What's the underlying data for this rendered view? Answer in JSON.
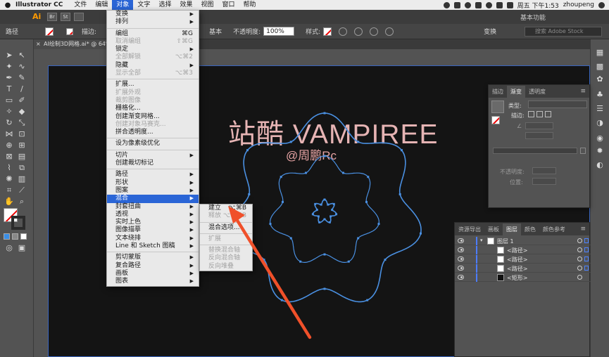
{
  "menubar": {
    "app_name": "Illustrator CC",
    "items": [
      "文件",
      "编辑",
      "对象",
      "文字",
      "选择",
      "效果",
      "视图",
      "窗口",
      "帮助"
    ],
    "active_index": 2,
    "clock": "周五 下午1:53",
    "user": "zhoupeng"
  },
  "appbar": {
    "logo": "Ai",
    "buttons": [
      "Br",
      "St"
    ],
    "workspace": "基本功能"
  },
  "controlbar": {
    "selection_label": "路径",
    "stroke_label": "描边:",
    "style_basic": "基本",
    "opacity_label": "不透明度:",
    "opacity_value": "100%",
    "style_label": "样式:",
    "transform_label": "变换",
    "search_placeholder": "搜索 Adobe Stock"
  },
  "doc_tab": {
    "close": "×",
    "title": "AI绘制3D网格.ai* @ 64% (RGB"
  },
  "artwork": {
    "title": "站酷 VAMPIREE",
    "subtitle": "@周鹏Rc"
  },
  "object_menu": [
    {
      "label": "变换",
      "arrow": true
    },
    {
      "label": "排列",
      "arrow": true
    },
    {
      "sep": true
    },
    {
      "label": "编组",
      "shortcut": "⌘G"
    },
    {
      "label": "取消编组",
      "shortcut": "⇧⌘G",
      "disabled": true
    },
    {
      "label": "锁定",
      "arrow": true
    },
    {
      "label": "全部解锁",
      "shortcut": "⌥⌘2",
      "disabled": true
    },
    {
      "label": "隐藏",
      "arrow": true
    },
    {
      "label": "显示全部",
      "shortcut": "⌥⌘3",
      "disabled": true
    },
    {
      "sep": true
    },
    {
      "label": "扩展..."
    },
    {
      "label": "扩展外观",
      "disabled": true
    },
    {
      "label": "裁剪图像",
      "disabled": true
    },
    {
      "label": "栅格化..."
    },
    {
      "label": "创建渐变网格..."
    },
    {
      "label": "创建对象马赛克...",
      "disabled": true
    },
    {
      "label": "拼合透明度..."
    },
    {
      "sep": true
    },
    {
      "label": "设为像素级优化"
    },
    {
      "sep": true
    },
    {
      "label": "切片",
      "arrow": true
    },
    {
      "label": "创建裁切标记"
    },
    {
      "sep": true
    },
    {
      "label": "路径",
      "arrow": true
    },
    {
      "label": "形状",
      "arrow": true
    },
    {
      "label": "图案",
      "arrow": true
    },
    {
      "label": "混合",
      "arrow": true,
      "highlight": true
    },
    {
      "label": "封套扭曲",
      "arrow": true
    },
    {
      "label": "透视",
      "arrow": true
    },
    {
      "label": "实时上色",
      "arrow": true
    },
    {
      "label": "图像描摹",
      "arrow": true
    },
    {
      "label": "文本绕排",
      "arrow": true
    },
    {
      "label": "Line 和 Sketch 图稿",
      "arrow": true
    },
    {
      "sep": true
    },
    {
      "label": "剪切蒙版",
      "arrow": true
    },
    {
      "label": "复合路径",
      "arrow": true
    },
    {
      "label": "画板",
      "arrow": true
    },
    {
      "label": "图表",
      "arrow": true
    }
  ],
  "blend_submenu": [
    {
      "label": "建立",
      "shortcut": "⌥⌘B"
    },
    {
      "label": "释放",
      "shortcut": "⌥⇧⌘B",
      "disabled": true
    },
    {
      "sep": true
    },
    {
      "label": "混合选项..."
    },
    {
      "sep": true
    },
    {
      "label": "扩展",
      "disabled": true
    },
    {
      "sep": true
    },
    {
      "label": "替换混合轴",
      "disabled": true
    },
    {
      "label": "反向混合轴",
      "disabled": true
    },
    {
      "label": "反向堆叠",
      "disabled": true
    }
  ],
  "gradient_panel": {
    "tabs": [
      "描边",
      "渐变",
      "透明度"
    ],
    "active_tab": 1,
    "type_label": "类型:",
    "stroke_label": "描边:",
    "opacity_label": "不透明度:",
    "position_label": "位置:"
  },
  "layers_panel": {
    "tabs": [
      "资源导出",
      "画板",
      "图层",
      "颜色",
      "颜色参考"
    ],
    "active_tab": 2,
    "layer_name": "图层 1",
    "sublayers": [
      "<路径>",
      "<路径>",
      "<路径>",
      "<矩形>"
    ]
  },
  "colors": {
    "annotation_arrow": "#f0502a",
    "path_stroke": "#4a90e2",
    "title_text": "#e6b4b4"
  }
}
